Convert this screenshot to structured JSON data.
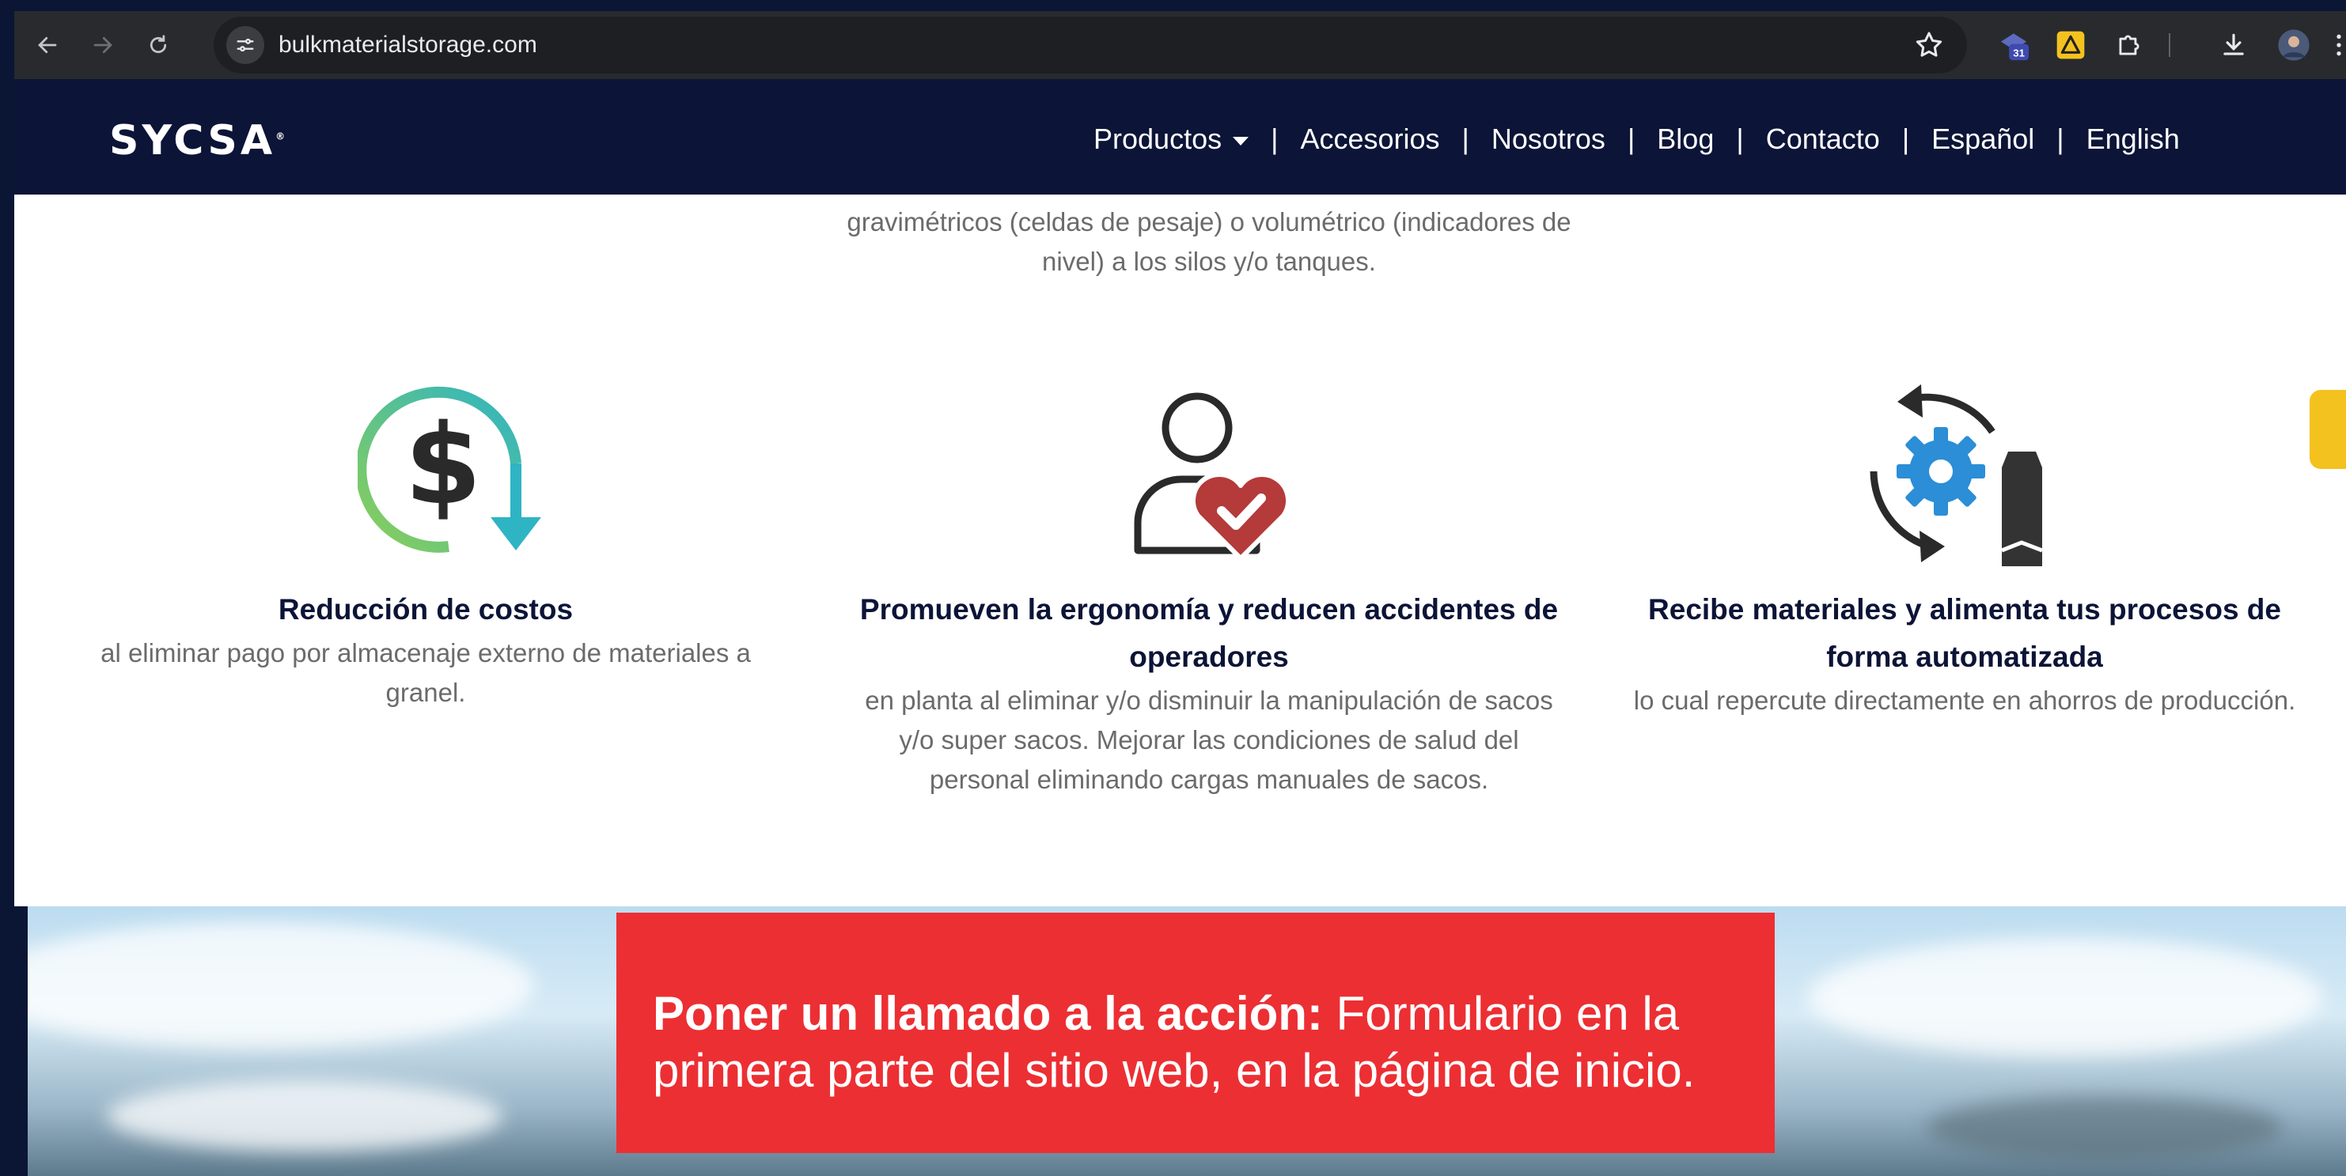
{
  "browser": {
    "url": "bulkmaterialstorage.com",
    "calendar_badge": "31"
  },
  "site": {
    "logo": "SYCSA",
    "nav": [
      {
        "label": "Productos",
        "has_dropdown": true
      },
      {
        "label": "Accesorios"
      },
      {
        "label": "Nosotros"
      },
      {
        "label": "Blog"
      },
      {
        "label": "Contacto"
      },
      {
        "label": "Español"
      },
      {
        "label": "English"
      }
    ],
    "separator": "|"
  },
  "intro": {
    "line1": "gravimétricos (celdas de pesaje) o volumétrico (indicadores de",
    "line2": "nivel) a los silos y/o tanques."
  },
  "features": [
    {
      "icon": "dollar-cost-reduction-icon",
      "title": "Reducción de costos",
      "description_lines": [
        "al eliminar pago por almacenaje externo de materiales a",
        "granel."
      ]
    },
    {
      "icon": "person-heart-check-icon",
      "title_lines": [
        "Promueven la ergonomía y reducen accidentes de",
        "operadores"
      ],
      "description_lines": [
        "en planta al eliminar y/o disminuir la manipulación de sacos",
        "y/o super sacos. Mejorar las condiciones de salud del",
        "personal eliminando cargas manuales de sacos."
      ]
    },
    {
      "icon": "gear-silo-automation-icon",
      "title_lines": [
        "Recibe materiales y alimenta tus procesos de",
        "forma automatizada"
      ],
      "description_lines": [
        "lo cual repercute directamente en ahorros de producción."
      ]
    }
  ],
  "cta": {
    "bold": "Poner un llamado a la acción:",
    "normal": " Formulario en la primera parte del sitio web, en la página de inicio."
  },
  "colors": {
    "header_bg": "#0c1437",
    "cta_bg": "#ec2f33",
    "heading": "#0c1437",
    "body_text": "#6b6b6b",
    "icon_gradient_start": "#8bcf57",
    "icon_gradient_end": "#2fb4c3",
    "heart": "#b53a3a",
    "gear": "#2b8ed6"
  }
}
